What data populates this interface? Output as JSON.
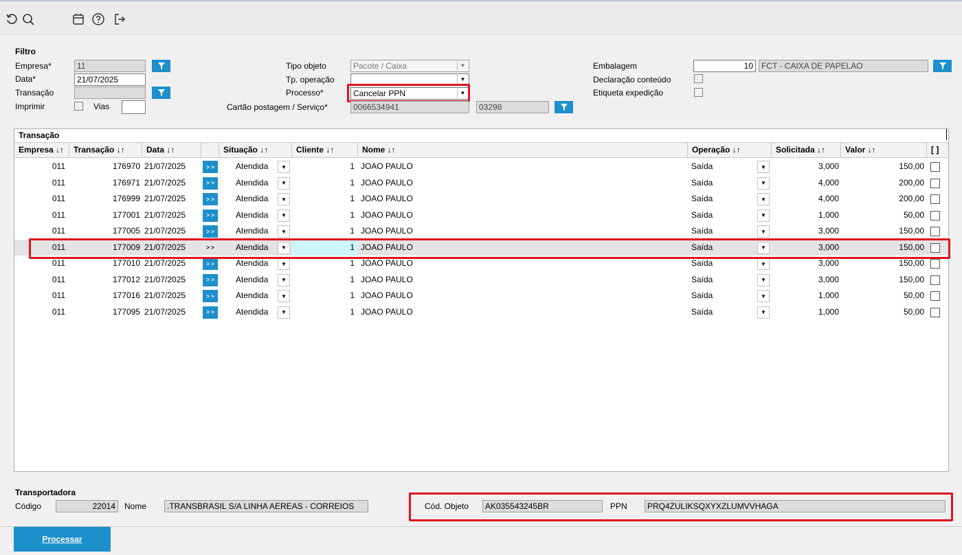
{
  "toolbar": {
    "icons": [
      "refresh-icon",
      "search-icon",
      "calendar-icon",
      "help-icon",
      "exit-icon"
    ]
  },
  "filtro": {
    "title": "Filtro",
    "empresa_label": "Empresa*",
    "empresa_value": "11",
    "data_label": "Data*",
    "data_value": "21/07/2025",
    "transacao_label": "Transação",
    "transacao_value": "",
    "imprimir_label": "Imprimir",
    "vias_label": "Vias",
    "vias_value": "",
    "tipo_objeto_label": "Tipo objeto",
    "tipo_objeto_value": "Pacote / Caixa",
    "tp_operacao_label": "Tp. operação",
    "tp_operacao_value": "",
    "processo_label": "Processo*",
    "processo_value": "Cancelar PPN",
    "cartao_label": "Cartão postagem / Serviço*",
    "cartao_value": "0066534941",
    "servico_value": "03298",
    "embalagem_label": "Embalagem",
    "embalagem_code": "10",
    "embalagem_desc": "FCT - CAIXA DE PAPELAO",
    "declaracao_label": "Declaração conteúdo",
    "etiqueta_label": "Etiqueta expedição"
  },
  "grid": {
    "title": "Transação",
    "headers": [
      "Empresa ↓↑",
      "Transação ↓↑",
      "Data ↓↑",
      "",
      "Situação ↓↑",
      "Cliente ↓↑",
      "Nome ↓↑",
      "Operação ↓↑",
      "Solicitada ↓↑",
      "Valor ↓↑",
      "[ ]"
    ],
    "arrow_label": "> >",
    "rows": [
      {
        "empresa": "011",
        "transacao": "176970",
        "data": "21/07/2025",
        "situacao": "Atendida",
        "cliente": "1",
        "nome": "JOAO PAULO",
        "operacao": "Saída",
        "solicitada": "3,000",
        "valor": "150,00"
      },
      {
        "empresa": "011",
        "transacao": "176971",
        "data": "21/07/2025",
        "situacao": "Atendida",
        "cliente": "1",
        "nome": "JOAO PAULO",
        "operacao": "Saída",
        "solicitada": "4,000",
        "valor": "200,00"
      },
      {
        "empresa": "011",
        "transacao": "176999",
        "data": "21/07/2025",
        "situacao": "Atendida",
        "cliente": "1",
        "nome": "JOAO PAULO",
        "operacao": "Saída",
        "solicitada": "4,000",
        "valor": "200,00"
      },
      {
        "empresa": "011",
        "transacao": "177001",
        "data": "21/07/2025",
        "situacao": "Atendida",
        "cliente": "1",
        "nome": "JOAO PAULO",
        "operacao": "Saída",
        "solicitada": "1,000",
        "valor": "50,00"
      },
      {
        "empresa": "011",
        "transacao": "177005",
        "data": "21/07/2025",
        "situacao": "Atendida",
        "cliente": "1",
        "nome": "JOAO PAULO",
        "operacao": "Saída",
        "solicitada": "3,000",
        "valor": "150,00"
      },
      {
        "empresa": "011",
        "transacao": "177009",
        "data": "21/07/2025",
        "situacao": "Atendida",
        "cliente": "1",
        "nome": "JOAO PAULO",
        "operacao": "Saída",
        "solicitada": "3,000",
        "valor": "150,00"
      },
      {
        "empresa": "011",
        "transacao": "177010",
        "data": "21/07/2025",
        "situacao": "Atendida",
        "cliente": "1",
        "nome": "JOAO PAULO",
        "operacao": "Saída",
        "solicitada": "3,000",
        "valor": "150,00"
      },
      {
        "empresa": "011",
        "transacao": "177012",
        "data": "21/07/2025",
        "situacao": "Atendida",
        "cliente": "1",
        "nome": "JOAO PAULO",
        "operacao": "Saída",
        "solicitada": "3,000",
        "valor": "150,00"
      },
      {
        "empresa": "011",
        "transacao": "177016",
        "data": "21/07/2025",
        "situacao": "Atendida",
        "cliente": "1",
        "nome": "JOAO PAULO",
        "operacao": "Saída",
        "solicitada": "1,000",
        "valor": "50,00"
      },
      {
        "empresa": "011",
        "transacao": "177095",
        "data": "21/07/2025",
        "situacao": "Atendida",
        "cliente": "1",
        "nome": "JOAO PAULO",
        "operacao": "Saída",
        "solicitada": "1,000",
        "valor": "50,00"
      }
    ]
  },
  "transportadora": {
    "title": "Transportadora",
    "codigo_label": "Código",
    "codigo_value": "22014",
    "nome_label": "Nome",
    "nome_value": ".TRANSBRASIL S/A LINHA AEREAS - CORREIOS",
    "cod_objeto_label": "Cód. Objeto",
    "cod_objeto_value": "AK035543245BR",
    "ppn_label": "PPN",
    "ppn_value": "PRQ4ZULIKSQXYXZLUMVVHAGA"
  },
  "actions": {
    "processar_label": "Processar"
  },
  "colors": {
    "accent": "#1d8fcb",
    "highlight": "#e0141e",
    "cyan_cell": "#ccf6fb"
  }
}
